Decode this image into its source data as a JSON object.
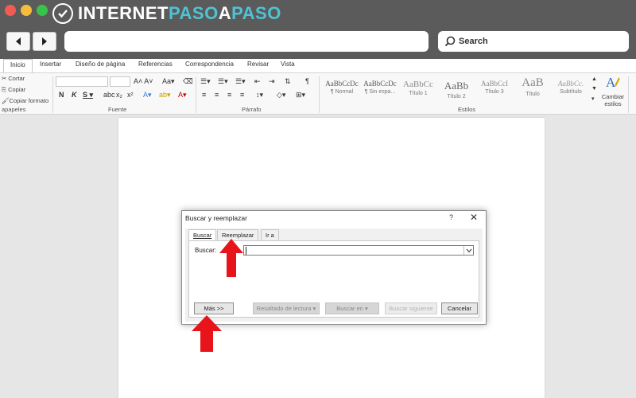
{
  "brand": {
    "part1": "INTERNET",
    "part2": "PASO",
    "part3": "A",
    "part4": "PASO",
    "colors": {
      "white": "#ffffff",
      "accent": "#4fc3d4"
    }
  },
  "browser": {
    "search_label": "Search"
  },
  "ribbon": {
    "tabs": [
      "Inicio",
      "Insertar",
      "Diseño de página",
      "Referencias",
      "Correspondencia",
      "Revisar",
      "Vista"
    ],
    "clipboard": {
      "cut": "Cortar",
      "copy": "Copiar",
      "format_painter": "Copiar formato",
      "group_label": "apapeles"
    },
    "font_group_label": "Fuente",
    "paragraph_group_label": "Párrafo",
    "styles_group_label": "Estilos",
    "styles": [
      {
        "preview": "AaBbCcDc",
        "name": "¶ Normal"
      },
      {
        "preview": "AaBbCcDc",
        "name": "¶ Sin espa..."
      },
      {
        "preview": "AaBbCc",
        "name": "Título 1"
      },
      {
        "preview": "AaBb",
        "name": "Título 2"
      },
      {
        "preview": "AaBbCcI",
        "name": "Título 3"
      },
      {
        "preview": "AaB",
        "name": "Título"
      },
      {
        "preview": "AaBbCc.",
        "name": "Subtítulo"
      }
    ],
    "change_styles": {
      "line1": "Cambiar",
      "line2": "estilos"
    }
  },
  "dialog": {
    "title": "Buscar y reemplazar",
    "help": "?",
    "close": "✕",
    "tabs": [
      "Buscar",
      "Reemplazar",
      "Ir a"
    ],
    "find_label": "Buscar:",
    "find_value": "",
    "buttons": {
      "more": "Más >>",
      "reading_highlight": "Resaltado de lectura ▾",
      "find_in": "Buscar en ▾",
      "find_next": "Buscar siguiente",
      "cancel": "Cancelar"
    }
  },
  "colors": {
    "chrome_bg": "#5b5b5b",
    "arrow": "#e8141c",
    "ribbon_bg": "#f8f8f8",
    "doc_bg": "#e6e6e6"
  }
}
